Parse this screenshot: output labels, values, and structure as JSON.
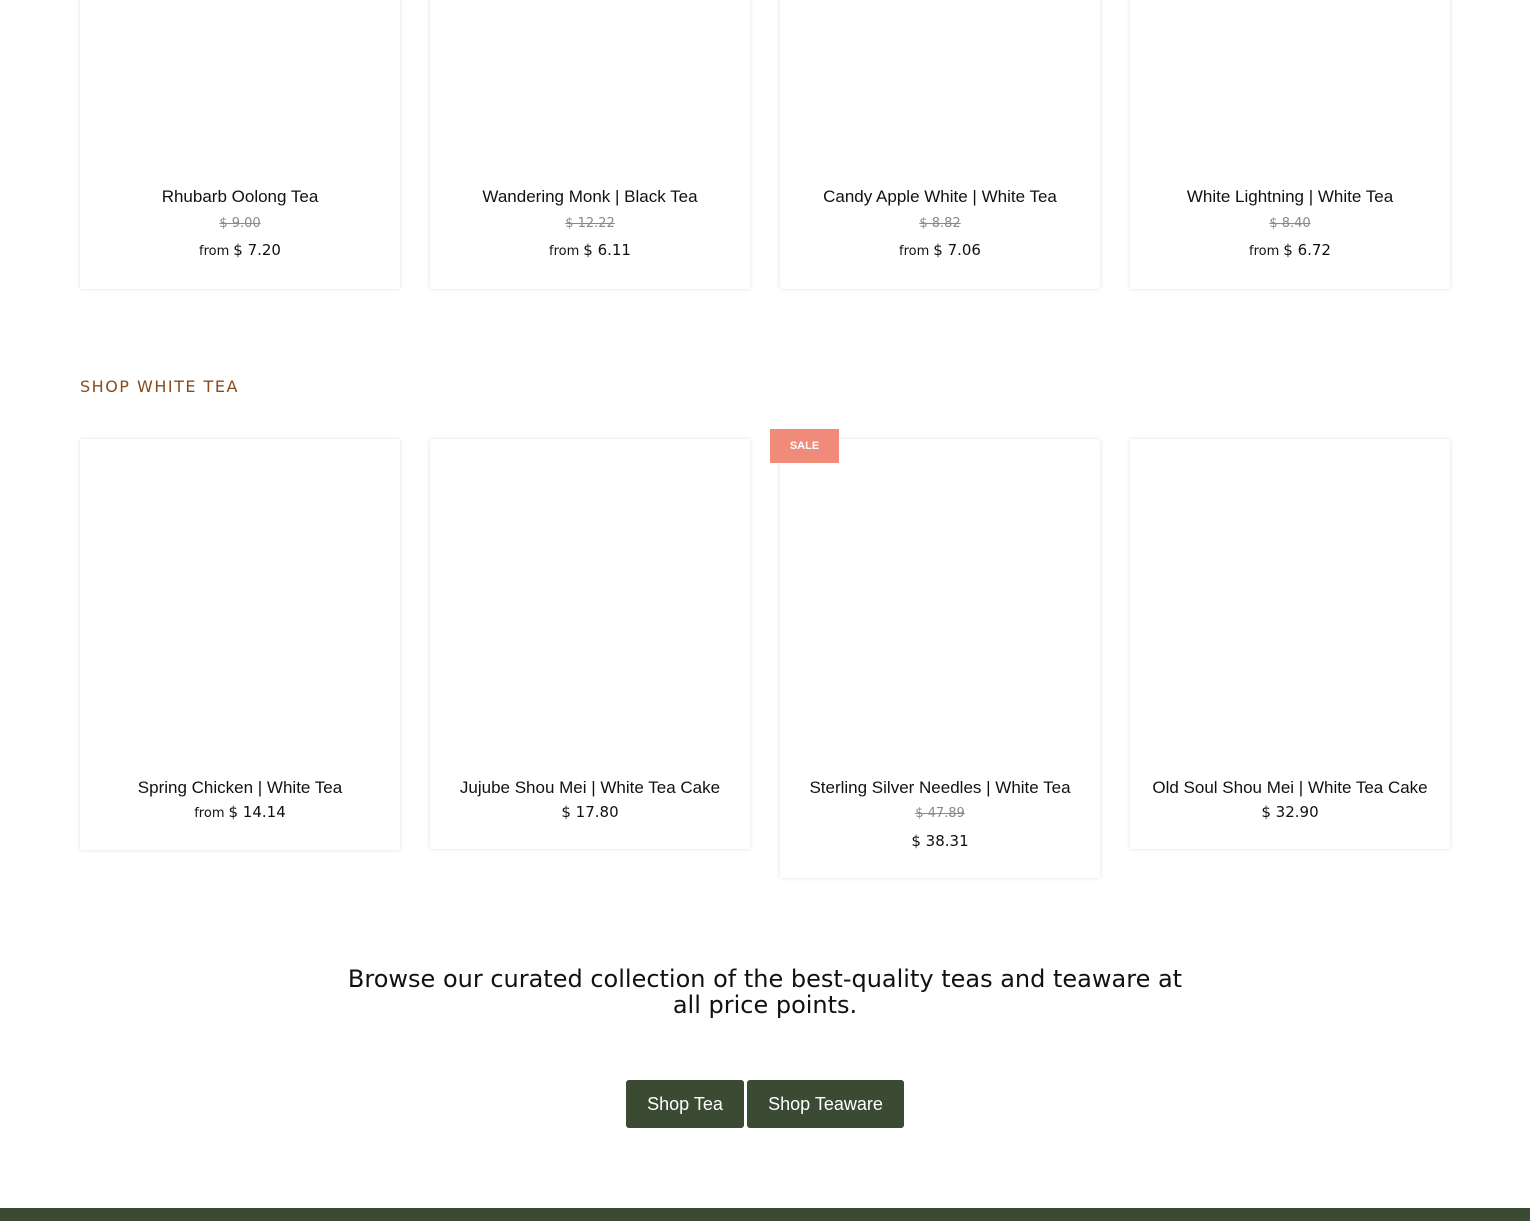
{
  "top_row": [
    {
      "title": "Rhubarb Oolong Tea",
      "compare_price": "$ 9.00",
      "from_label": "from",
      "price": "$ 7.20"
    },
    {
      "title": "Wandering Monk | Black Tea",
      "compare_price": "$ 12.22",
      "from_label": "from",
      "price": "$ 6.11"
    },
    {
      "title": "Candy Apple White | White Tea",
      "compare_price": "$ 8.82",
      "from_label": "from",
      "price": "$ 7.06"
    },
    {
      "title": "White Lightning | White Tea",
      "compare_price": "$ 8.40",
      "from_label": "from",
      "price": "$ 6.72"
    }
  ],
  "white_tea": {
    "heading": "SHOP WHITE TEA",
    "sale_badge": "SALE",
    "products": [
      {
        "title": "Spring Chicken | White Tea",
        "from_label": "from",
        "price": "$ 14.14"
      },
      {
        "title": "Jujube Shou Mei | White Tea Cake",
        "price": "$ 17.80"
      },
      {
        "title": "Sterling Silver Needles | White Tea",
        "compare_price": "$ 47.89",
        "price": "$ 38.31"
      },
      {
        "title": "Old Soul Shou Mei | White Tea Cake",
        "price": "$ 32.90"
      }
    ]
  },
  "browse": {
    "text": "Browse our curated collection of the best-quality teas and teaware at all price points.",
    "shop_tea_label": "Shop Tea",
    "shop_teaware_label": "Shop Teaware"
  },
  "colors": {
    "accent_heading": "#8a4b1c",
    "sale_badge": "#ef8b78",
    "button": "#3a4a33"
  }
}
